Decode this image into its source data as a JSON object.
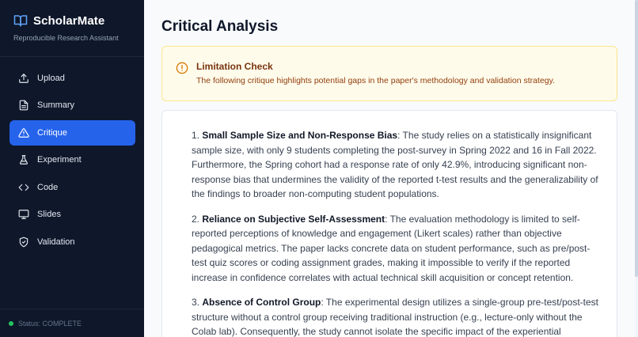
{
  "app": {
    "name": "ScholarMate",
    "subtitle": "Reproducible Research Assistant"
  },
  "sidebar": {
    "items": [
      {
        "label": "Upload",
        "icon": "upload-icon",
        "active": false
      },
      {
        "label": "Summary",
        "icon": "document-icon",
        "active": false
      },
      {
        "label": "Critique",
        "icon": "warning-icon",
        "active": true
      },
      {
        "label": "Experiment",
        "icon": "flask-icon",
        "active": false
      },
      {
        "label": "Code",
        "icon": "code-icon",
        "active": false
      },
      {
        "label": "Slides",
        "icon": "presentation-icon",
        "active": false
      },
      {
        "label": "Validation",
        "icon": "shield-check-icon",
        "active": false
      }
    ],
    "status": "Status: COMPLETE"
  },
  "main": {
    "title": "Critical Analysis",
    "alert": {
      "title": "Limitation Check",
      "text": "The following critique highlights potential gaps in the paper's methodology and validation strategy."
    },
    "points": [
      {
        "number": "1.",
        "heading": "Small Sample Size and Non-Response Bias",
        "text": ": The study relies on a statistically insignificant sample size, with only 9 students completing the post-survey in Spring 2022 and 16 in Fall 2022. Furthermore, the Spring cohort had a response rate of only 42.9%, introducing significant non-response bias that undermines the validity of the reported t-test results and the generalizability of the findings to broader non-computing student populations."
      },
      {
        "number": "2.",
        "heading": "Reliance on Subjective Self-Assessment",
        "text": ": The evaluation methodology is limited to self-reported perceptions of knowledge and engagement (Likert scales) rather than objective pedagogical metrics. The paper lacks concrete data on student performance, such as pre/post-test quiz scores or coding assignment grades, making it impossible to verify if the reported increase in confidence correlates with actual technical skill acquisition or concept retention."
      },
      {
        "number": "3.",
        "heading": "Absence of Control Group",
        "text": ": The experimental design utilizes a single-group pre-test/post-test structure without a control group receiving traditional instruction (e.g., lecture-only without the Colab lab). Consequently, the study cannot isolate the specific impact of the experiential"
      }
    ]
  },
  "colors": {
    "sidebar_bg": "#0f172a",
    "accent": "#2563eb",
    "alert_bg": "#fffbeb",
    "alert_icon": "#d97706",
    "status_dot": "#22c55e"
  }
}
